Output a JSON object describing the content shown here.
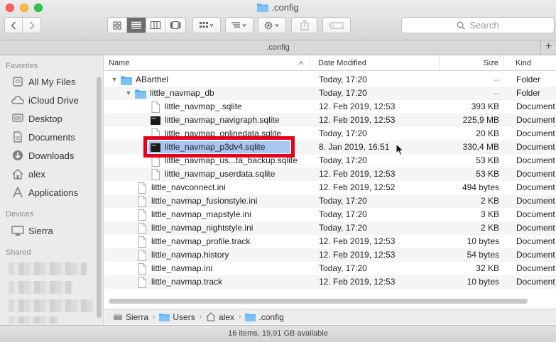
{
  "window": {
    "title": ".config"
  },
  "toolbar": {
    "search_placeholder": "Search"
  },
  "tabbar": {
    "label": ".config",
    "add": "+"
  },
  "sidebar": {
    "favorites_header": "Favorites",
    "favorites": [
      {
        "label": "All My Files",
        "icon": "all-files-icon"
      },
      {
        "label": "iCloud Drive",
        "icon": "cloud-icon"
      },
      {
        "label": "Desktop",
        "icon": "desktop-icon"
      },
      {
        "label": "Documents",
        "icon": "documents-icon"
      },
      {
        "label": "Downloads",
        "icon": "downloads-icon"
      },
      {
        "label": "alex",
        "icon": "home-icon"
      },
      {
        "label": "Applications",
        "icon": "applications-icon"
      }
    ],
    "devices_header": "Devices",
    "devices": [
      {
        "label": "Sierra",
        "icon": "computer-icon"
      }
    ],
    "shared_header": "Shared"
  },
  "columns": {
    "name": "Name",
    "date": "Date Modified",
    "size": "Size",
    "kind": "Kind"
  },
  "rows": [
    {
      "name": "ABarthel",
      "date": "Today, 17:20",
      "size": "--",
      "kind": "Folder",
      "type": "folder",
      "disclosure": "open"
    },
    {
      "name": "little_navmap_db",
      "date": "Today, 17:20",
      "size": "--",
      "kind": "Folder",
      "type": "folder",
      "disclosure": "open"
    },
    {
      "name": "little_navmap_.sqlite",
      "date": "12. Feb 2019, 12:53",
      "size": "393 KB",
      "kind": "Document",
      "type": "doc"
    },
    {
      "name": "little_navmap_navigraph.sqlite",
      "date": "12. Feb 2019, 12:53",
      "size": "225,9 MB",
      "kind": "Document",
      "type": "db"
    },
    {
      "name": "little_navmap_onlinedata.sqlite",
      "date": "Today, 17:20",
      "size": "20 KB",
      "kind": "Document",
      "type": "doc"
    },
    {
      "name": "little_navmap_p3dv4.sqlite",
      "date": "8. Jan 2019, 16:51",
      "size": "330,4 MB",
      "kind": "Document",
      "type": "db",
      "selected": true
    },
    {
      "name": "little_navmap_us...ta_backup.sqlite",
      "date": "Today, 17:20",
      "size": "53 KB",
      "kind": "Document",
      "type": "doc"
    },
    {
      "name": "little_navmap_userdata.sqlite",
      "date": "12. Feb 2019, 12:53",
      "size": "53 KB",
      "kind": "Document",
      "type": "doc"
    },
    {
      "name": "little_navconnect.ini",
      "date": "12. Feb 2019, 12:52",
      "size": "494 bytes",
      "kind": "Document",
      "type": "doc"
    },
    {
      "name": "little_navmap_fusionstyle.ini",
      "date": "Today, 17:20",
      "size": "2 KB",
      "kind": "Document",
      "type": "doc"
    },
    {
      "name": "little_navmap_mapstyle.ini",
      "date": "Today, 17:20",
      "size": "3 KB",
      "kind": "Document",
      "type": "doc"
    },
    {
      "name": "little_navmap_nightstyle.ini",
      "date": "Today, 17:20",
      "size": "2 KB",
      "kind": "Document",
      "type": "doc"
    },
    {
      "name": "little_navmap_profile.track",
      "date": "12. Feb 2019, 12:53",
      "size": "10 bytes",
      "kind": "Document",
      "type": "doc"
    },
    {
      "name": "little_navmap.history",
      "date": "12. Feb 2019, 12:53",
      "size": "54 bytes",
      "kind": "Document",
      "type": "doc"
    },
    {
      "name": "little_navmap.ini",
      "date": "Today, 17:20",
      "size": "32 KB",
      "kind": "Document",
      "type": "doc"
    },
    {
      "name": "little_navmap.track",
      "date": "12. Feb 2019, 12:53",
      "size": "10 bytes",
      "kind": "Document",
      "type": "doc"
    }
  ],
  "pathbar": [
    {
      "label": "Sierra",
      "icon": "drive-icon"
    },
    {
      "label": "Users",
      "icon": "folder-icon"
    },
    {
      "label": "alex",
      "icon": "home-icon"
    },
    {
      "label": ".config",
      "icon": "folder-icon"
    }
  ],
  "status": {
    "text": "16 items, 19,91 GB available"
  },
  "colors": {
    "selection": "#a9c6f2",
    "highlight_box": "#e6001b",
    "folder": "#5ab0f5"
  }
}
